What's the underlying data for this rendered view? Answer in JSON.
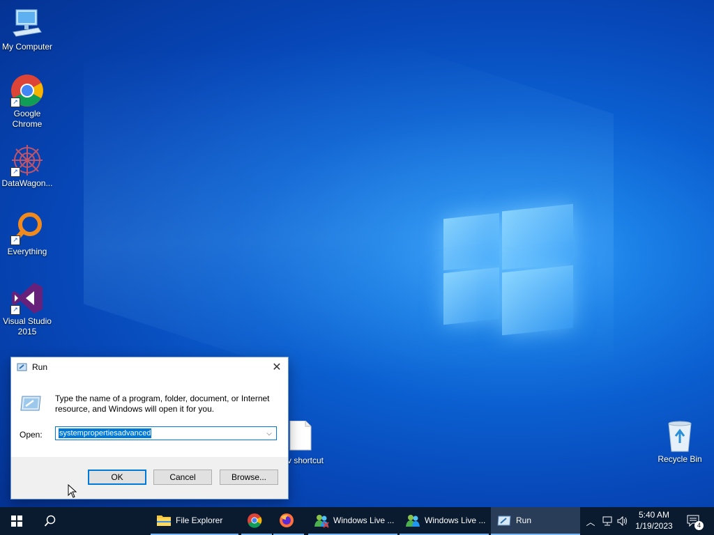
{
  "desktop": {
    "icons": [
      {
        "label": "My Computer",
        "icon": "computer-icon"
      },
      {
        "label": "Google Chrome",
        "icon": "chrome-icon"
      },
      {
        "label": "DataWagon...",
        "icon": "datawagon-icon"
      },
      {
        "label": "Everything",
        "icon": "everything-search-icon"
      },
      {
        "label": "Visual Studio 2015",
        "icon": "visual-studio-icon"
      },
      {
        "label": "Recycle Bin",
        "icon": "recycle-bin-icon"
      },
      {
        "label": "v shortcut",
        "icon": "file-shortcut-icon"
      }
    ]
  },
  "run_dialog": {
    "title": "Run",
    "description": "Type the name of a program, folder, document, or Internet resource, and Windows will open it for you.",
    "open_label": "Open:",
    "open_value": "systempropertiesadvanced",
    "buttons": {
      "ok": "OK",
      "cancel": "Cancel",
      "browse": "Browse..."
    }
  },
  "taskbar": {
    "items": [
      {
        "label": "File Explorer",
        "icon": "folder-icon"
      },
      {
        "label": "",
        "icon": "chrome-icon"
      },
      {
        "label": "",
        "icon": "firefox-icon"
      },
      {
        "label": "Windows Live ...",
        "icon": "messenger-icon"
      },
      {
        "label": "Windows Live ...",
        "icon": "messenger-icon"
      },
      {
        "label": "Run",
        "icon": "run-icon"
      }
    ],
    "clock": {
      "time": "5:40 AM",
      "date": "1/19/2023"
    },
    "notifications_count": "4"
  },
  "colors": {
    "accent": "#0078d7",
    "taskbar": "#0a1a2f",
    "desktop": "#0b5fd0"
  }
}
